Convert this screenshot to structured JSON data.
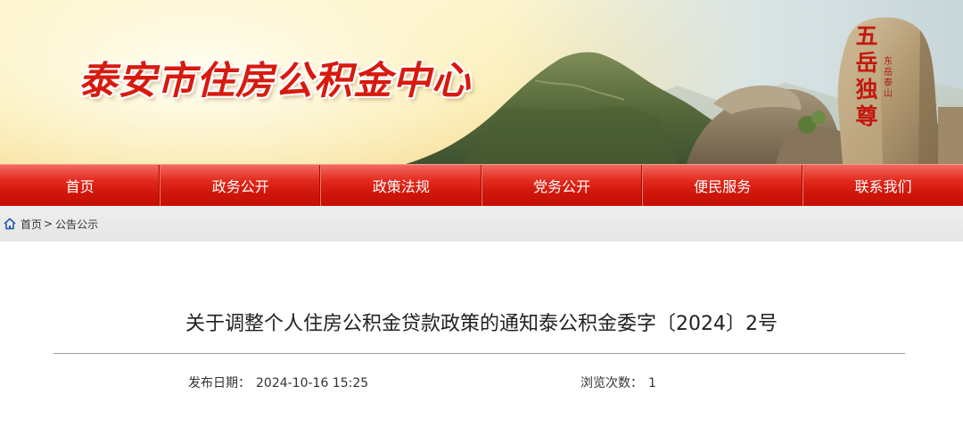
{
  "site": {
    "title": "泰安市住房公积金中心",
    "rock_inscription": [
      "五",
      "岳",
      "独",
      "尊"
    ],
    "rock_side_text": "东岳泰山"
  },
  "nav": {
    "items": [
      {
        "label": "首页"
      },
      {
        "label": "政务公开"
      },
      {
        "label": "政策法规"
      },
      {
        "label": "党务公开"
      },
      {
        "label": "便民服务"
      },
      {
        "label": "联系我们"
      }
    ]
  },
  "breadcrumb": {
    "home": "首页",
    "separator": ">",
    "current": "公告公示"
  },
  "article": {
    "title": "关于调整个人住房公积金贷款政策的通知泰公积金委字〔2024〕2号",
    "publish_label": "发布日期：",
    "publish_value": "2024-10-16 15:25",
    "views_label": "浏览次数：",
    "views_value": "1"
  },
  "colors": {
    "brand_red": "#d81a0e",
    "nav_red": "#cf1509",
    "breadcrumb_bg": "#e9e9e9"
  }
}
